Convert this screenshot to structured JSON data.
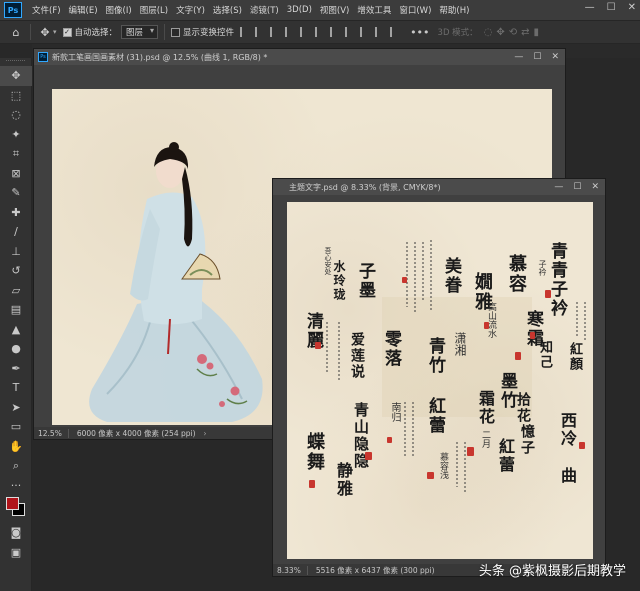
{
  "menubar": {
    "items": [
      "文件(F)",
      "编辑(E)",
      "图像(I)",
      "图层(L)",
      "文字(Y)",
      "选择(S)",
      "滤镜(T)",
      "3D(D)",
      "视图(V)",
      "增效工具",
      "窗口(W)",
      "帮助(H)"
    ],
    "window_controls": [
      "—",
      "☐",
      "✕"
    ]
  },
  "options_bar": {
    "auto_select_label": "自动选择：",
    "auto_select_checked": true,
    "auto_select_target": "图层",
    "show_transform_label": "显示变换控件",
    "show_transform_checked": false,
    "mode_3d_label": "3D 模式："
  },
  "doc1": {
    "title": "新款工笔画国画素材 (31).psd @ 12.5% (曲线 1, RGB/8) *",
    "zoom": "12.5%",
    "size_info": "6000 像素 x 4000 像素 (254 ppi)"
  },
  "doc2": {
    "title": "主题文字.psd @ 8.33% (背景, CMYK/8*)",
    "zoom": "8.33%",
    "size_info": "5516 像素 x 6437 像素 (300 ppi)",
    "calligraphy": [
      "青青子衿",
      "子衿",
      "慕容",
      "寒霜",
      "嫺雅",
      "美眷",
      "子墨",
      "水玲珑",
      "清麗",
      "知己",
      "紅顏",
      "拾花",
      "憶子",
      "墨竹",
      "潇湘",
      "零落",
      "青竹",
      "紅蕾",
      "霜花",
      "二月",
      "紅蕾",
      "西冷",
      "曲",
      "爱莲说",
      "青山隐隐",
      "蝶舞",
      "静雅",
      "南归",
      "慕容浅",
      "高山流水",
      "吾心安处"
    ]
  },
  "watermark": "头条 @紫枫摄影后期教学",
  "colors": {
    "foreground": "#b0141a",
    "background": "#000000",
    "accent": "#31a8ff"
  }
}
